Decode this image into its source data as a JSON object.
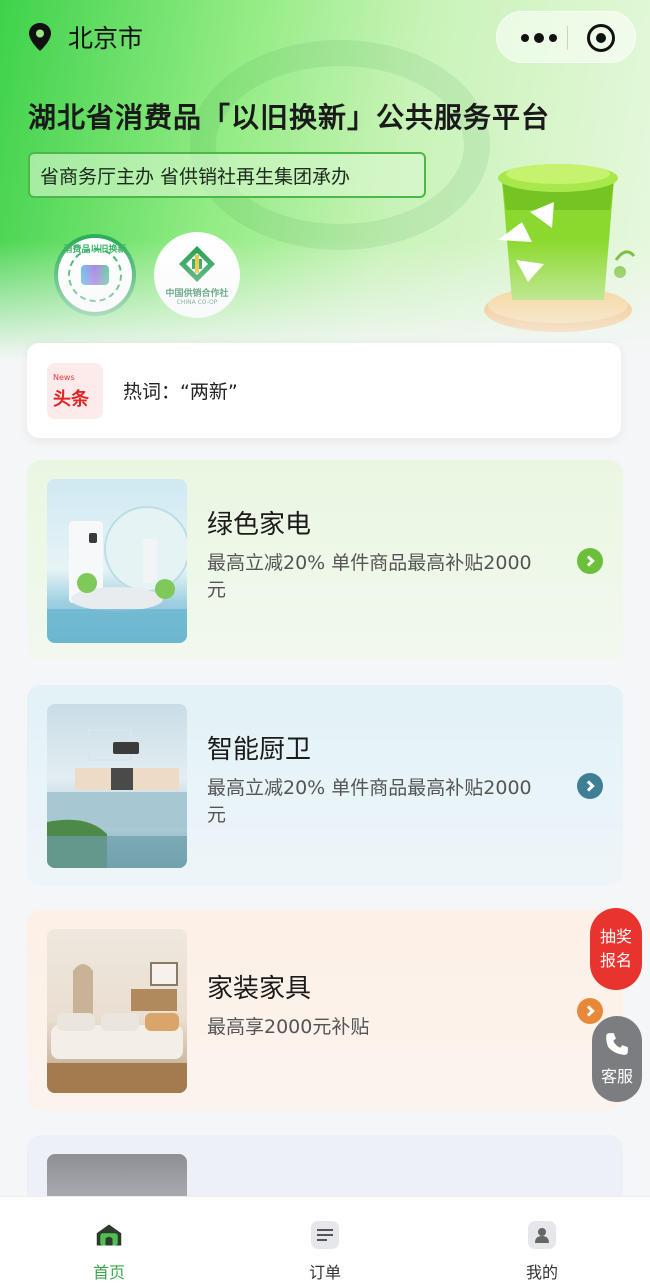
{
  "status": {
    "location": "北京市"
  },
  "header": {
    "title": "湖北省消费品「以旧换新」公共服务平台",
    "subtitle": "省商务厅主办 省供销社再生集团承办",
    "badge1_text": "消费品以旧换新",
    "badge2_cn": "中国供销合作社",
    "badge2_en": "CHINA CO-OP"
  },
  "news": {
    "icon_small": "News",
    "icon_big": "头条",
    "hotword": "热词：“两新”"
  },
  "cards": [
    {
      "title": "绿色家电",
      "desc": "最高立减20% 单件商品最高补贴2000元",
      "arrow_color": "#6bbf3a"
    },
    {
      "title": "智能厨卫",
      "desc": "最高立减20% 单件商品最高补贴2000元",
      "arrow_color": "#3f7f95"
    },
    {
      "title": "家装家具",
      "desc": "最高享2000元补贴",
      "arrow_color": "#e8893a"
    }
  ],
  "floating": {
    "lottery_line1": "抽奖",
    "lottery_line2": "报名",
    "service": "客服"
  },
  "tabbar": [
    {
      "label": "首页",
      "active": true
    },
    {
      "label": "订单",
      "active": false
    },
    {
      "label": "我的",
      "active": false
    }
  ],
  "colors": {
    "accent_green": "#3aa84a",
    "lottery_red": "#e8332e",
    "service_gray": "#7c7d80"
  }
}
